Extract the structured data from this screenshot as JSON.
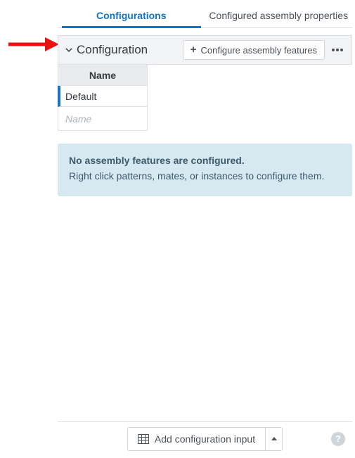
{
  "tabs": {
    "configurations": "Configurations",
    "configured_properties": "Configured assembly properties"
  },
  "section": {
    "title": "Configuration",
    "configure_button": "Configure assembly features"
  },
  "table": {
    "header": "Name",
    "row0": "Default",
    "placeholder": "Name"
  },
  "notice": {
    "title": "No assembly features are configured.",
    "body": "Right click patterns, mates, or instances to configure them."
  },
  "footer": {
    "add_input": "Add configuration input"
  }
}
